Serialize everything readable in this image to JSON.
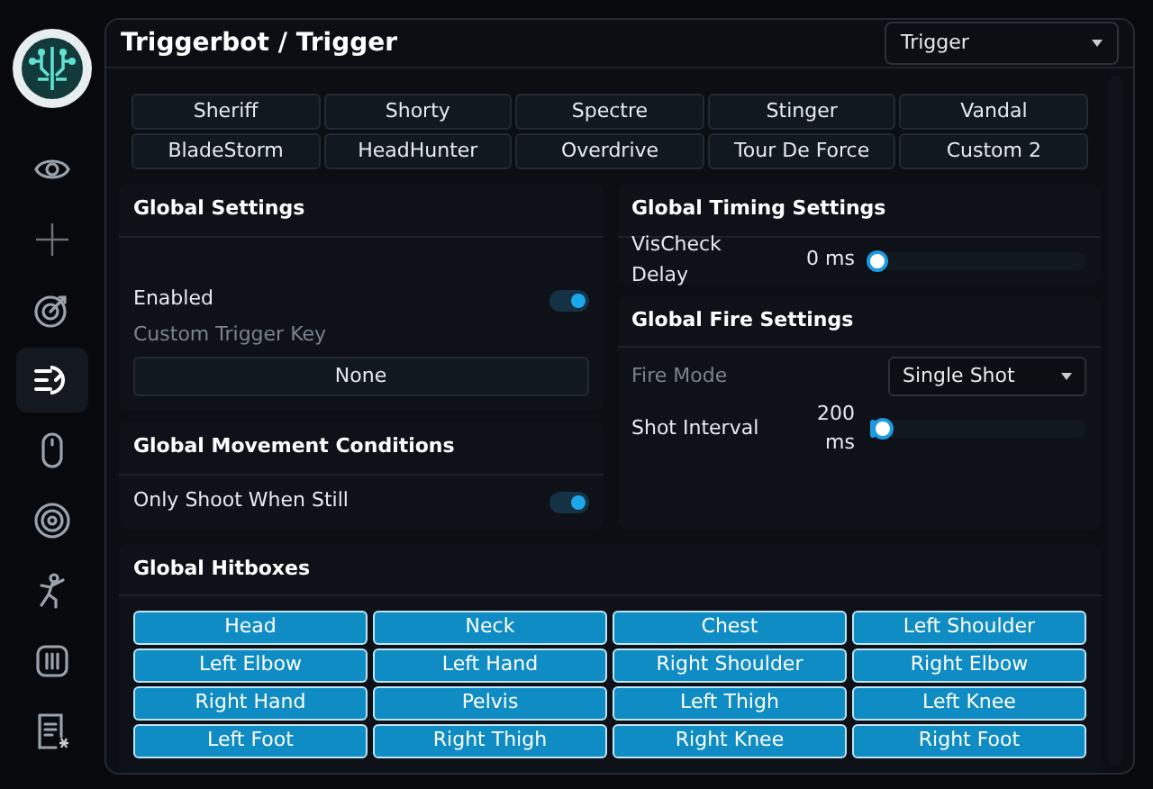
{
  "sidebar": {
    "items": [
      {
        "kind": "eye",
        "selected": false
      },
      {
        "kind": "crosshair",
        "selected": false
      },
      {
        "kind": "target",
        "selected": false
      },
      {
        "kind": "speed",
        "selected": true
      },
      {
        "kind": "mouse",
        "selected": false
      },
      {
        "kind": "radar",
        "selected": false
      },
      {
        "kind": "figure",
        "selected": false
      },
      {
        "kind": "sliders",
        "selected": false
      },
      {
        "kind": "list",
        "selected": false
      }
    ]
  },
  "header": {
    "title": "Triggerbot / Trigger",
    "select": "Trigger"
  },
  "weapons": [
    {
      "label": "Sheriff"
    },
    {
      "label": "Shorty"
    },
    {
      "label": "Spectre"
    },
    {
      "label": "Stinger"
    },
    {
      "label": "Vandal"
    },
    {
      "label": "BladeStorm"
    },
    {
      "label": "HeadHunter"
    },
    {
      "label": "Overdrive"
    },
    {
      "label": "Tour De Force"
    },
    {
      "label": "Custom 2"
    }
  ],
  "global_settings": {
    "title": "Global Settings",
    "enabled": {
      "label": "Enabled",
      "on": true
    },
    "key_label": "Custom Trigger Key",
    "key_dim": true,
    "key_button": "None"
  },
  "movement": {
    "title": "Global Movement Conditions",
    "rows": [
      {
        "label": "Only Shoot When Still",
        "on": true
      }
    ]
  },
  "timing": {
    "title": "Global Timing Settings",
    "sliders": [
      {
        "label": "VisCheck Delay",
        "reading": "0 ms",
        "level": 0
      }
    ]
  },
  "fire": {
    "title": "Global Fire Settings",
    "mode_label": "Fire Mode",
    "mode_dim": true,
    "mode_value": "Single Shot",
    "sliders": [
      {
        "label": "Shot Interval",
        "reading": "200 ms",
        "level": 0.03
      }
    ]
  },
  "hitboxes": {
    "title": "Global Hitboxes",
    "items": [
      {
        "label": "Head",
        "selected": true
      },
      {
        "label": "Neck",
        "selected": true
      },
      {
        "label": "Chest",
        "selected": true
      },
      {
        "label": "Left Shoulder",
        "selected": true
      },
      {
        "label": "Left Elbow",
        "selected": true
      },
      {
        "label": "Left Hand",
        "selected": true
      },
      {
        "label": "Right Shoulder",
        "selected": true
      },
      {
        "label": "Right Elbow",
        "selected": true
      },
      {
        "label": "Right Hand",
        "selected": true
      },
      {
        "label": "Pelvis",
        "selected": true
      },
      {
        "label": "Left Thigh",
        "selected": true
      },
      {
        "label": "Left Knee",
        "selected": true
      },
      {
        "label": "Left Foot",
        "selected": true
      },
      {
        "label": "Right Thigh",
        "selected": true
      },
      {
        "label": "Right Knee",
        "selected": true
      },
      {
        "label": "Right Foot",
        "selected": true
      }
    ]
  }
}
